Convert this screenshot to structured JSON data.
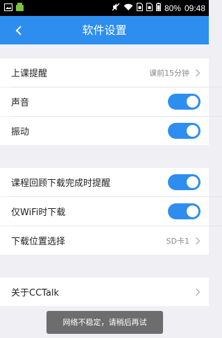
{
  "statusbar": {
    "battery_percent": "80%",
    "time": "09:48"
  },
  "appbar": {
    "title": "软件设置"
  },
  "settings": {
    "class_reminder": {
      "label": "上课提醒",
      "value": "课前15分钟"
    },
    "sound": {
      "label": "声音",
      "enabled": true
    },
    "vibration": {
      "label": "振动",
      "enabled": true
    },
    "replay_download_notify": {
      "label": "课程回顾下载完成时提醒",
      "enabled": true
    },
    "wifi_only_download": {
      "label": "仅WiFi时下载",
      "enabled": true
    },
    "download_location": {
      "label": "下载位置选择",
      "value": "SD卡1"
    },
    "about": {
      "label": "关于CCTalk"
    }
  },
  "toast": {
    "message": "网络不稳定，请稍后再试"
  },
  "colors": {
    "accent": "#2d8ef0",
    "background": "#efeff4"
  }
}
